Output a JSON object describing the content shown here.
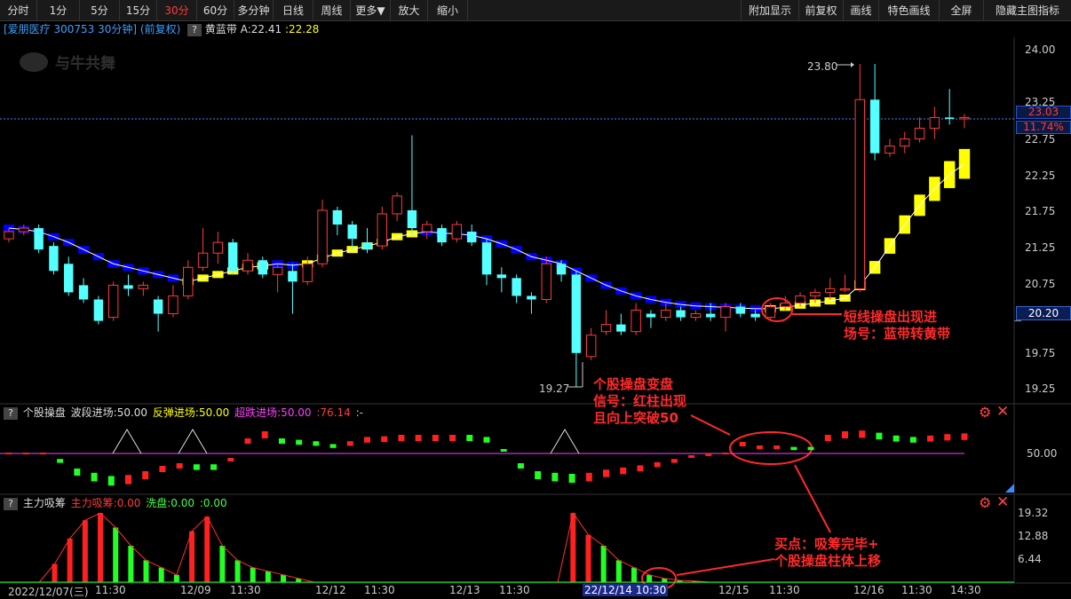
{
  "toolbar": {
    "left": [
      "分时",
      "1分",
      "5分",
      "15分",
      "30分",
      "60分",
      "多分钟",
      "日线",
      "周线",
      "更多▼",
      "放大",
      "缩小"
    ],
    "active": "30分",
    "right": [
      "附加显示",
      "前复权",
      "画线",
      "特色画线",
      "全屏",
      "隐藏主图指标"
    ]
  },
  "header": {
    "stock": "[爱朋医疗 300753 30分钟] (前复权)",
    "indicator_name": "黄蓝带",
    "indicator_a": "A:22.41",
    "indicator_b": ":22.28"
  },
  "watermark": "与牛共舞",
  "price_axis": {
    "ticks": [
      "24.00",
      "23.25",
      "22.75",
      "22.25",
      "21.75",
      "21.25",
      "20.75",
      "20.20",
      "19.75",
      "19.25"
    ],
    "current_price": "23.03",
    "current_pct": "11.74%",
    "cross_price": "20.20"
  },
  "price_annotations": {
    "high_label": "23.80",
    "low_label": "19.27"
  },
  "callouts": {
    "short_signal": [
      "短线操盘出现进",
      "场号：蓝带转黄带"
    ],
    "stock_signal": [
      "个股操盘变盘",
      "信号：红柱出现",
      "且向上突破50"
    ],
    "buy_point": [
      "买点：吸筹完毕+",
      "个股操盘柱体上移"
    ]
  },
  "panel2": {
    "name": "个股操盘",
    "p1": "波段进场:50.00",
    "p2": "反弹进场:50.00",
    "p3": "超跌进场:50.00",
    "p4": ":76.14",
    "p5": ":-",
    "axis_label": "50.00",
    "colors": {
      "p1": "#dddddd",
      "p2": "#ffff00",
      "p3": "#ff40ff",
      "p4": "#ff3b3b"
    }
  },
  "panel3": {
    "name": "主力吸筹",
    "p1": "主力吸筹:0.00",
    "p2": "洗盘:0.00",
    "p3": ":0.00",
    "axis_ticks": [
      "19.32",
      "12.88",
      "6.44"
    ]
  },
  "xaxis": {
    "labels": [
      "2022/12/07(三)",
      "11:30",
      "12/09",
      "11:30",
      "12/12",
      "11:30",
      "12/13",
      "11:30",
      "12/22/12/14",
      "10:30",
      "12/15",
      "11:30",
      "12/16",
      "11:30",
      "14:30"
    ],
    "cursor_label": "22/12/14 10:30"
  },
  "chart_data": {
    "type": "candlestick",
    "title": "爱朋医疗 300753 30分钟",
    "ylim": [
      19.1,
      24.2
    ],
    "candles": [
      {
        "o": 21.35,
        "c": 21.45,
        "h": 21.5,
        "l": 21.3
      },
      {
        "o": 21.45,
        "c": 21.5,
        "h": 21.55,
        "l": 21.4
      },
      {
        "o": 21.5,
        "c": 21.2,
        "h": 21.55,
        "l": 21.15
      },
      {
        "o": 21.25,
        "c": 20.9,
        "h": 21.3,
        "l": 20.85
      },
      {
        "o": 21.0,
        "c": 20.6,
        "h": 21.1,
        "l": 20.55
      },
      {
        "o": 20.7,
        "c": 20.5,
        "h": 20.8,
        "l": 20.45
      },
      {
        "o": 20.5,
        "c": 20.2,
        "h": 20.55,
        "l": 20.15
      },
      {
        "o": 20.25,
        "c": 20.7,
        "h": 20.75,
        "l": 20.2
      },
      {
        "o": 20.7,
        "c": 20.65,
        "h": 20.85,
        "l": 20.55
      },
      {
        "o": 20.65,
        "c": 20.7,
        "h": 20.75,
        "l": 20.55
      },
      {
        "o": 20.5,
        "c": 20.3,
        "h": 20.55,
        "l": 20.05
      },
      {
        "o": 20.3,
        "c": 20.55,
        "h": 20.7,
        "l": 20.25
      },
      {
        "o": 20.55,
        "c": 20.95,
        "h": 21.05,
        "l": 20.5
      },
      {
        "o": 20.95,
        "c": 21.15,
        "h": 21.5,
        "l": 20.9
      },
      {
        "o": 21.15,
        "c": 21.3,
        "h": 21.45,
        "l": 21.0
      },
      {
        "o": 21.3,
        "c": 20.9,
        "h": 21.35,
        "l": 20.85
      },
      {
        "o": 20.9,
        "c": 21.05,
        "h": 21.15,
        "l": 20.85
      },
      {
        "o": 21.05,
        "c": 20.85,
        "h": 21.1,
        "l": 20.8
      },
      {
        "o": 20.85,
        "c": 20.95,
        "h": 21.0,
        "l": 20.6
      },
      {
        "o": 20.9,
        "c": 20.75,
        "h": 21.0,
        "l": 20.3
      },
      {
        "o": 20.75,
        "c": 21.0,
        "h": 21.1,
        "l": 20.7
      },
      {
        "o": 21.0,
        "c": 21.75,
        "h": 21.9,
        "l": 20.95
      },
      {
        "o": 21.75,
        "c": 21.55,
        "h": 21.8,
        "l": 21.4
      },
      {
        "o": 21.55,
        "c": 21.35,
        "h": 21.6,
        "l": 21.2
      },
      {
        "o": 21.3,
        "c": 21.2,
        "h": 21.5,
        "l": 21.15
      },
      {
        "o": 21.25,
        "c": 21.7,
        "h": 21.8,
        "l": 21.2
      },
      {
        "o": 21.7,
        "c": 21.95,
        "h": 22.0,
        "l": 21.6
      },
      {
        "o": 21.75,
        "c": 21.5,
        "h": 22.8,
        "l": 21.4
      },
      {
        "o": 21.45,
        "c": 21.55,
        "h": 21.6,
        "l": 21.35
      },
      {
        "o": 21.5,
        "c": 21.3,
        "h": 21.55,
        "l": 21.25
      },
      {
        "o": 21.35,
        "c": 21.55,
        "h": 21.6,
        "l": 21.3
      },
      {
        "o": 21.45,
        "c": 21.3,
        "h": 21.55,
        "l": 21.25
      },
      {
        "o": 21.3,
        "c": 20.85,
        "h": 21.35,
        "l": 20.7
      },
      {
        "o": 20.85,
        "c": 20.8,
        "h": 20.95,
        "l": 20.6
      },
      {
        "o": 20.8,
        "c": 20.55,
        "h": 20.85,
        "l": 20.45
      },
      {
        "o": 20.55,
        "c": 20.5,
        "h": 20.6,
        "l": 20.3
      },
      {
        "o": 20.5,
        "c": 21.0,
        "h": 21.1,
        "l": 20.45
      },
      {
        "o": 21.0,
        "c": 20.85,
        "h": 21.05,
        "l": 20.75
      },
      {
        "o": 20.85,
        "c": 19.75,
        "h": 20.9,
        "l": 19.27
      },
      {
        "o": 19.7,
        "c": 20.0,
        "h": 20.1,
        "l": 19.65
      },
      {
        "o": 20.05,
        "c": 20.15,
        "h": 20.35,
        "l": 20.0
      },
      {
        "o": 20.15,
        "c": 20.05,
        "h": 20.3,
        "l": 20.0
      },
      {
        "o": 20.05,
        "c": 20.35,
        "h": 20.45,
        "l": 20.0
      },
      {
        "o": 20.3,
        "c": 20.25,
        "h": 20.35,
        "l": 20.1
      },
      {
        "o": 20.25,
        "c": 20.35,
        "h": 20.45,
        "l": 20.2
      },
      {
        "o": 20.35,
        "c": 20.25,
        "h": 20.4,
        "l": 20.2
      },
      {
        "o": 20.25,
        "c": 20.3,
        "h": 20.35,
        "l": 20.2
      },
      {
        "o": 20.3,
        "c": 20.25,
        "h": 20.45,
        "l": 20.2
      },
      {
        "o": 20.25,
        "c": 20.4,
        "h": 20.45,
        "l": 20.05
      },
      {
        "o": 20.4,
        "c": 20.3,
        "h": 20.45,
        "l": 20.25
      },
      {
        "o": 20.3,
        "c": 20.25,
        "h": 20.35,
        "l": 20.2
      },
      {
        "o": 20.25,
        "c": 20.4,
        "h": 20.45,
        "l": 20.2
      },
      {
        "o": 20.4,
        "c": 20.45,
        "h": 20.55,
        "l": 20.35
      },
      {
        "o": 20.45,
        "c": 20.55,
        "h": 20.6,
        "l": 20.4
      },
      {
        "o": 20.55,
        "c": 20.6,
        "h": 20.65,
        "l": 20.45
      },
      {
        "o": 20.6,
        "c": 20.65,
        "h": 20.8,
        "l": 20.5
      },
      {
        "o": 20.65,
        "c": 20.65,
        "h": 20.85,
        "l": 20.6
      },
      {
        "o": 20.65,
        "c": 23.3,
        "h": 23.8,
        "l": 20.6
      },
      {
        "o": 23.3,
        "c": 22.55,
        "h": 23.8,
        "l": 22.45
      },
      {
        "o": 22.55,
        "c": 22.65,
        "h": 22.75,
        "l": 22.5
      },
      {
        "o": 22.65,
        "c": 22.75,
        "h": 22.85,
        "l": 22.55
      },
      {
        "o": 22.75,
        "c": 22.9,
        "h": 23.05,
        "l": 22.7
      },
      {
        "o": 22.9,
        "c": 23.05,
        "h": 23.2,
        "l": 22.75
      },
      {
        "o": 23.05,
        "c": 23.03,
        "h": 23.45,
        "l": 22.95
      },
      {
        "o": 23.03,
        "c": 23.05,
        "h": 23.1,
        "l": 22.9
      }
    ],
    "band": [
      {
        "v": 21.5,
        "c": "blue"
      },
      {
        "v": 21.48,
        "c": "blue"
      },
      {
        "v": 21.45,
        "c": "blue"
      },
      {
        "v": 21.38,
        "c": "blue"
      },
      {
        "v": 21.3,
        "c": "blue"
      },
      {
        "v": 21.2,
        "c": "blue"
      },
      {
        "v": 21.1,
        "c": "blue"
      },
      {
        "v": 21.0,
        "c": "blue"
      },
      {
        "v": 20.95,
        "c": "blue"
      },
      {
        "v": 20.9,
        "c": "blue"
      },
      {
        "v": 20.85,
        "c": "blue"
      },
      {
        "v": 20.8,
        "c": "blue"
      },
      {
        "v": 20.75,
        "c": "yellow"
      },
      {
        "v": 20.8,
        "c": "yellow"
      },
      {
        "v": 20.85,
        "c": "yellow"
      },
      {
        "v": 20.9,
        "c": "yellow"
      },
      {
        "v": 20.95,
        "c": "yellow"
      },
      {
        "v": 20.97,
        "c": "yellow"
      },
      {
        "v": 21.0,
        "c": "blue"
      },
      {
        "v": 20.98,
        "c": "blue"
      },
      {
        "v": 21.0,
        "c": "yellow"
      },
      {
        "v": 21.08,
        "c": "yellow"
      },
      {
        "v": 21.15,
        "c": "yellow"
      },
      {
        "v": 21.2,
        "c": "yellow"
      },
      {
        "v": 21.25,
        "c": "yellow"
      },
      {
        "v": 21.3,
        "c": "yellow"
      },
      {
        "v": 21.38,
        "c": "yellow"
      },
      {
        "v": 21.42,
        "c": "yellow"
      },
      {
        "v": 21.45,
        "c": "blue"
      },
      {
        "v": 21.43,
        "c": "blue"
      },
      {
        "v": 21.42,
        "c": "blue"
      },
      {
        "v": 21.4,
        "c": "blue"
      },
      {
        "v": 21.35,
        "c": "blue"
      },
      {
        "v": 21.28,
        "c": "blue"
      },
      {
        "v": 21.2,
        "c": "blue"
      },
      {
        "v": 21.1,
        "c": "blue"
      },
      {
        "v": 21.05,
        "c": "blue"
      },
      {
        "v": 21.0,
        "c": "blue"
      },
      {
        "v": 20.9,
        "c": "blue"
      },
      {
        "v": 20.8,
        "c": "blue"
      },
      {
        "v": 20.7,
        "c": "blue"
      },
      {
        "v": 20.62,
        "c": "blue"
      },
      {
        "v": 20.55,
        "c": "blue"
      },
      {
        "v": 20.5,
        "c": "blue"
      },
      {
        "v": 20.46,
        "c": "blue"
      },
      {
        "v": 20.43,
        "c": "blue"
      },
      {
        "v": 20.41,
        "c": "blue"
      },
      {
        "v": 20.4,
        "c": "blue"
      },
      {
        "v": 20.39,
        "c": "blue"
      },
      {
        "v": 20.38,
        "c": "blue"
      },
      {
        "v": 20.37,
        "c": "blue"
      },
      {
        "v": 20.37,
        "c": "yellow"
      },
      {
        "v": 20.39,
        "c": "yellow"
      },
      {
        "v": 20.42,
        "c": "yellow"
      },
      {
        "v": 20.45,
        "c": "yellow"
      },
      {
        "v": 20.48,
        "c": "yellow"
      },
      {
        "v": 20.52,
        "c": "yellow"
      },
      {
        "v": 20.7,
        "c": "yellow"
      },
      {
        "v": 20.95,
        "c": "yellow"
      },
      {
        "v": 21.25,
        "c": "yellow"
      },
      {
        "v": 21.55,
        "c": "yellow"
      },
      {
        "v": 21.82,
        "c": "yellow"
      },
      {
        "v": 22.05,
        "c": "yellow"
      },
      {
        "v": 22.25,
        "c": "yellow"
      },
      {
        "v": 22.4,
        "c": "yellow"
      }
    ],
    "stock_op_bars": [
      {
        "v": 0,
        "c": "red"
      },
      {
        "v": 0,
        "c": "red"
      },
      {
        "v": 0,
        "c": "red"
      },
      {
        "v": -12,
        "c": "green"
      },
      {
        "v": -30,
        "c": "green"
      },
      {
        "v": -38,
        "c": "green"
      },
      {
        "v": -44,
        "c": "green"
      },
      {
        "v": -42,
        "c": "red"
      },
      {
        "v": -35,
        "c": "red"
      },
      {
        "v": -25,
        "c": "red"
      },
      {
        "v": -20,
        "c": "red"
      },
      {
        "v": -22,
        "c": "green"
      },
      {
        "v": -22,
        "c": "green"
      },
      {
        "v": -10,
        "c": "red"
      },
      {
        "v": 20,
        "c": "red"
      },
      {
        "v": 30,
        "c": "red"
      },
      {
        "v": 20,
        "c": "green"
      },
      {
        "v": 18,
        "c": "green"
      },
      {
        "v": 16,
        "c": "green"
      },
      {
        "v": 12,
        "c": "green"
      },
      {
        "v": 16,
        "c": "red"
      },
      {
        "v": 22,
        "c": "red"
      },
      {
        "v": 23,
        "c": "red"
      },
      {
        "v": 25,
        "c": "red"
      },
      {
        "v": 25,
        "c": "red"
      },
      {
        "v": 25,
        "c": "red"
      },
      {
        "v": 25,
        "c": "red"
      },
      {
        "v": 25,
        "c": "green"
      },
      {
        "v": 22,
        "c": "green"
      },
      {
        "v": 5,
        "c": "green"
      },
      {
        "v": -20,
        "c": "green"
      },
      {
        "v": -35,
        "c": "green"
      },
      {
        "v": -38,
        "c": "green"
      },
      {
        "v": -40,
        "c": "green"
      },
      {
        "v": -38,
        "c": "red"
      },
      {
        "v": -32,
        "c": "red"
      },
      {
        "v": -28,
        "c": "red"
      },
      {
        "v": -24,
        "c": "red"
      },
      {
        "v": -18,
        "c": "red"
      },
      {
        "v": -12,
        "c": "red"
      },
      {
        "v": -5,
        "c": "red"
      },
      {
        "v": -2,
        "c": "red"
      },
      {
        "v": 0,
        "c": "red"
      },
      {
        "v": 15,
        "c": "red"
      },
      {
        "v": 10,
        "c": "red"
      },
      {
        "v": 10,
        "c": "red"
      },
      {
        "v": 8,
        "c": "green"
      },
      {
        "v": 8,
        "c": "green"
      },
      {
        "v": 25,
        "c": "red"
      },
      {
        "v": 30,
        "c": "red"
      },
      {
        "v": 31,
        "c": "red"
      },
      {
        "v": 28,
        "c": "green"
      },
      {
        "v": 24,
        "c": "green"
      },
      {
        "v": 22,
        "c": "green"
      },
      {
        "v": 24,
        "c": "red"
      },
      {
        "v": 26,
        "c": "red"
      },
      {
        "v": 27,
        "c": "red"
      }
    ],
    "accum_bars": [
      {
        "v": 0
      },
      {
        "v": 0
      },
      {
        "v": 0
      },
      {
        "v": 5,
        "c": "red"
      },
      {
        "v": 12,
        "c": "red"
      },
      {
        "v": 17,
        "c": "red"
      },
      {
        "v": 19,
        "c": "red"
      },
      {
        "v": 15,
        "c": "green"
      },
      {
        "v": 10,
        "c": "green"
      },
      {
        "v": 6,
        "c": "green"
      },
      {
        "v": 4,
        "c": "green"
      },
      {
        "v": 2,
        "c": "green"
      },
      {
        "v": 14,
        "c": "red"
      },
      {
        "v": 18,
        "c": "red"
      },
      {
        "v": 10,
        "c": "green"
      },
      {
        "v": 6,
        "c": "green"
      },
      {
        "v": 4,
        "c": "green"
      },
      {
        "v": 3,
        "c": "green"
      },
      {
        "v": 2,
        "c": "green"
      },
      {
        "v": 1,
        "c": "green"
      },
      {
        "v": 0
      },
      {
        "v": 0
      },
      {
        "v": 0
      },
      {
        "v": 0
      },
      {
        "v": 0
      },
      {
        "v": 0
      },
      {
        "v": 0
      },
      {
        "v": 0
      },
      {
        "v": 0
      },
      {
        "v": 0
      },
      {
        "v": 0
      },
      {
        "v": 0
      },
      {
        "v": 0
      },
      {
        "v": 0
      },
      {
        "v": 0
      },
      {
        "v": 0
      },
      {
        "v": 0
      },
      {
        "v": 19,
        "c": "red"
      },
      {
        "v": 13,
        "c": "red"
      },
      {
        "v": 10,
        "c": "green"
      },
      {
        "v": 6,
        "c": "green"
      },
      {
        "v": 4,
        "c": "green"
      },
      {
        "v": 2,
        "c": "green"
      },
      {
        "v": 1,
        "c": "green"
      },
      {
        "v": 0.5,
        "c": "green"
      },
      {
        "v": 0.3,
        "c": "green"
      },
      {
        "v": 0
      },
      {
        "v": 0
      }
    ]
  }
}
